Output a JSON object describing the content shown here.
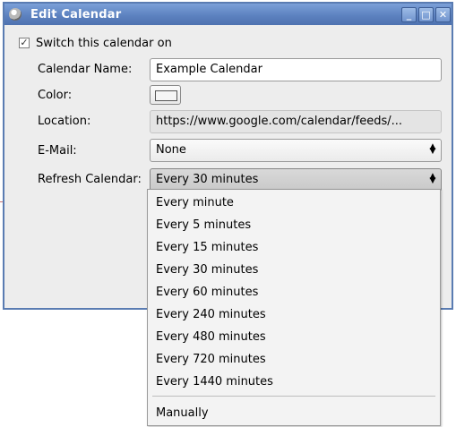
{
  "window": {
    "title": "Edit Calendar",
    "buttons": {
      "minimize": "_",
      "maximize": "□",
      "close": "✕"
    }
  },
  "form": {
    "switch_label": "Switch this calendar on",
    "switch_checked": true,
    "switch_mark": "✓",
    "name_label": "Calendar Name:",
    "name_value": "Example Calendar",
    "color_label": "Color:",
    "color_value": "#f5f5f5",
    "location_label": "Location:",
    "location_value": "https://www.google.com/calendar/feeds/...",
    "email_label": "E-Mail:",
    "email_value": "None",
    "refresh_label": "Refresh Calendar:",
    "refresh_value": "Every 30 minutes",
    "spin_glyph_up": "▲",
    "spin_glyph_down": "▼"
  },
  "refresh_options": [
    "Every minute",
    "Every 5 minutes",
    "Every 15 minutes",
    "Every 30 minutes",
    "Every 60 minutes",
    "Every 240 minutes",
    "Every 480 minutes",
    "Every 720 minutes",
    "Every 1440 minutes",
    "Manually"
  ],
  "icons": {
    "app": "calendar-app-icon",
    "checkbox": "checkmark-icon",
    "spin": "updown-arrows-icon"
  }
}
